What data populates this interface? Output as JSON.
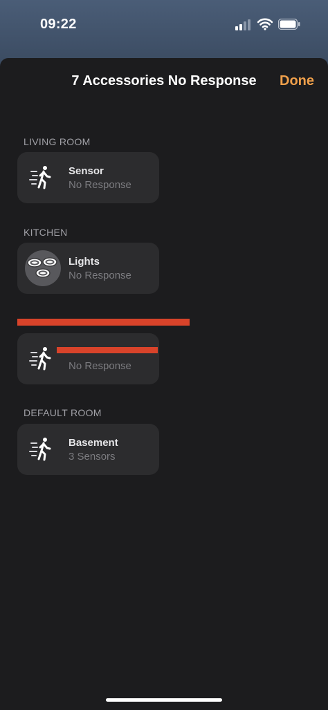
{
  "status_bar": {
    "time": "09:22"
  },
  "sheet": {
    "title": "7 Accessories No Response",
    "done_label": "Done"
  },
  "sections": [
    {
      "header": "LIVING ROOM",
      "tile": {
        "name": "Sensor",
        "status": "No Response",
        "icon": "motion-sensor-icon"
      }
    },
    {
      "header": "KITCHEN",
      "tile": {
        "name": "Lights",
        "status": "No Response",
        "icon": "lights-icon"
      }
    },
    {
      "header": "",
      "tile": {
        "name": "",
        "status": "No Response",
        "icon": "motion-sensor-icon"
      }
    },
    {
      "header": "DEFAULT ROOM",
      "tile": {
        "name": "Basement",
        "status": "3 Sensors",
        "icon": "motion-sensor-icon"
      }
    }
  ],
  "colors": {
    "accent": "#f0a04b",
    "sheet_bg": "#1c1c1e",
    "tile_bg": "#2c2c2e",
    "redaction": "#d8432a"
  }
}
